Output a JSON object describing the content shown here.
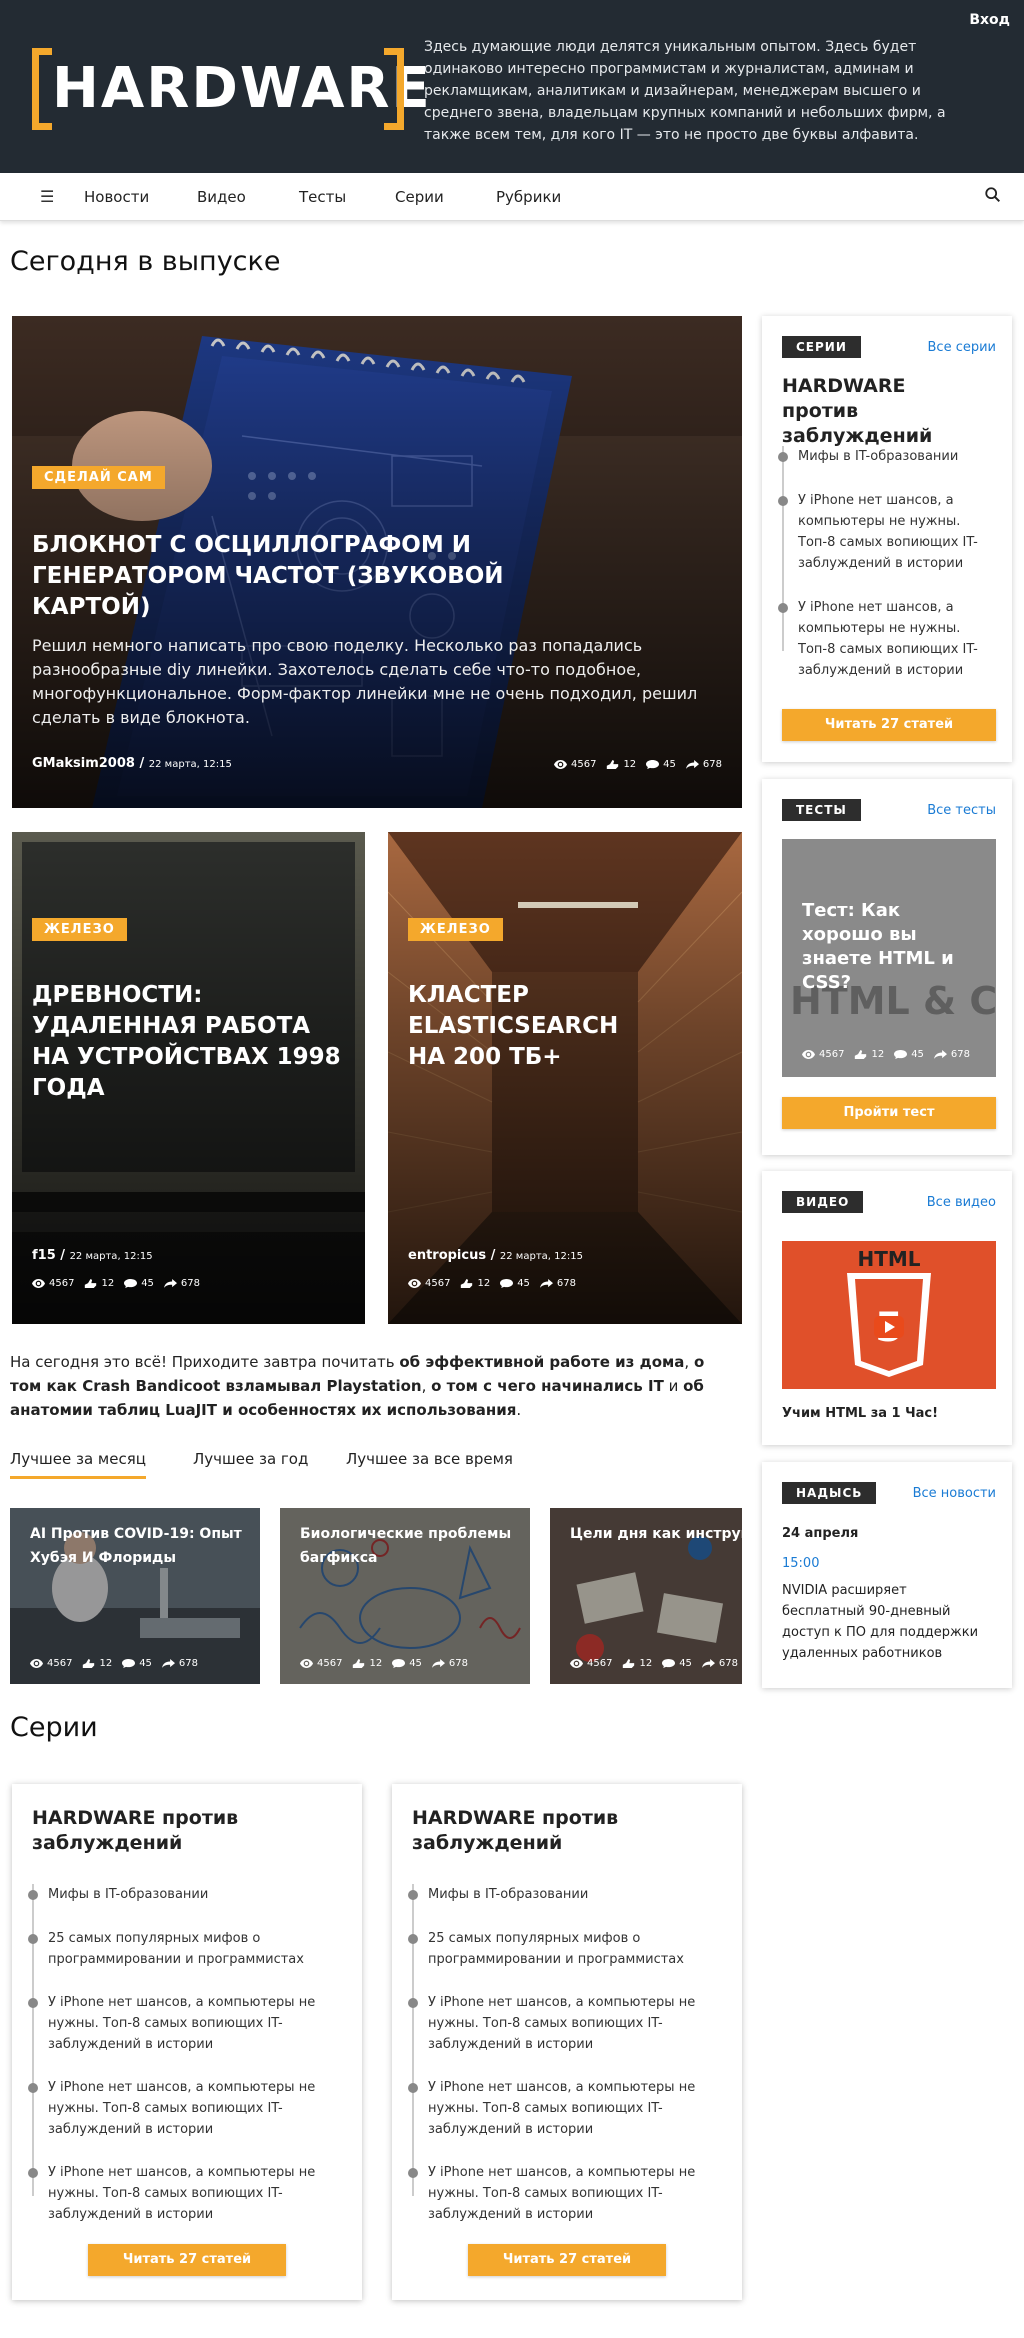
{
  "header": {
    "logo_text": "HARDWARE",
    "tagline": "Здесь думающие люди делятся уникальным опытом. Здесь будет одинаково интересно программистам и журналистам, админам и рекламщикам, аналитикам и дизайнерам, менеджерам высшего и среднего звена, владельцам крупных компаний и небольших фирм, а также всем тем, для кого IT — это не просто две буквы алфавита.",
    "login": "Вход"
  },
  "nav": {
    "menu_icon": "hamburger-icon",
    "items": [
      "Новости",
      "Видео",
      "Тесты",
      "Серии",
      "Рубрики"
    ],
    "search_icon": "search-icon"
  },
  "today_heading": "Сегодня в выпуске",
  "featured": {
    "badge": "СДЕЛАЙ САМ",
    "title": "Блокнот с осциллографом и генератором частот (звуковой картой)",
    "desc": "Решил немного написать про свою поделку. Несколько раз попадались разнообразные diy линейки. Захотелось сделать себе что-то подобное, многофункциональное. Форм-фактор линейки мне не очень подходил, решил сделать в виде блокнота.",
    "author": "GMaksim2008",
    "date": "22 марта, 12:15",
    "views": "4567",
    "likes": "12",
    "comments": "45",
    "shares": "678"
  },
  "cards": [
    {
      "badge": "ЖЕЛЕЗО",
      "title": "Древности: удаленная работа на устройствах 1998 года",
      "author": "f15",
      "date": "22 марта, 12:15",
      "views": "4567",
      "likes": "12",
      "comments": "45",
      "shares": "678"
    },
    {
      "badge": "ЖЕЛЕЗО",
      "title": "Кластер Elasticsearch на 200 ТБ+",
      "author": "entropicus",
      "date": "22 марта, 12:15",
      "views": "4567",
      "likes": "12",
      "comments": "45",
      "shares": "678"
    }
  ],
  "closing": {
    "lead": "На сегодня это всё! Приходите завтра почитать ",
    "bold1": "об эффективной работе из дома",
    "sep1": ", ",
    "bold2": "о том как Crash Bandicoot взламывал Playstation",
    "sep2": ", ",
    "bold3": "о том с чего начинались IT",
    "sep3": " и ",
    "bold4": "об анатомии таблиц LuaJIT и особенностях их использования",
    "end": "."
  },
  "best_tabs": [
    "Лучшее за месяц",
    "Лучшее за год",
    "Лучшее за все время"
  ],
  "best": [
    {
      "title": "AI Против COVID-19: Опыт Хубэя И Флориды",
      "views": "4567",
      "likes": "12",
      "comments": "45",
      "shares": "678"
    },
    {
      "title": "Биологические проблемы багфикса",
      "views": "4567",
      "likes": "12",
      "comments": "45",
      "shares": "678"
    },
    {
      "title": "Цели дня как инструмент управления командой",
      "views": "4567",
      "likes": "12",
      "comments": "45",
      "shares": "678"
    }
  ],
  "series_heading": "Серии",
  "side_series": {
    "tag": "СЕРИИ",
    "all": "Все серии",
    "title": "HARDWARE против заблуждений",
    "items": [
      "Мифы в IT-образовании",
      "У iPhone нет шансов, а компьютеры не нужны. Топ-8 самых вопиющих IT-заблуждений в истории",
      "У iPhone нет шансов, а компьютеры не нужны. Топ-8 самых вопиющих IT-заблуждений в истории"
    ],
    "button": "Читать 27 статей"
  },
  "side_tests": {
    "tag": "ТЕСТЫ",
    "all": "Все тесты",
    "title": "Тест: Как хорошо вы знаете HTML и CSS?",
    "image_text": "HTML & CSS",
    "views": "4567",
    "likes": "12",
    "comments": "45",
    "shares": "678",
    "button": "Пройти тест"
  },
  "side_video": {
    "tag": "ВИДЕО",
    "all": "Все видео",
    "image_text": "HTML",
    "image_number": "5",
    "caption": "Учим HTML за 1 Час!"
  },
  "side_news": {
    "tag": "НАДЫСЬ",
    "all": "Все новости",
    "date": "24 апреля",
    "time": "15:00",
    "text": "NVIDIA расширяет бесплатный 90-дневный доступ к ПО для поддержки удаленных работников"
  },
  "series_cards": [
    {
      "title": "HARDWARE против заблуждений",
      "items": [
        "Мифы в IT-образовании",
        "25 самых популярных мифов о программировании и программистах",
        "У iPhone нет шансов, а компьютеры не нужны. Топ-8 самых вопиющих IT-заблуждений в истории",
        "У iPhone нет шансов, а компьютеры не нужны. Топ-8 самых вопиющих IT-заблуждений в истории",
        "У iPhone нет шансов, а компьютеры не нужны. Топ-8 самых вопиющих IT-заблуждений в истории"
      ],
      "button": "Читать 27 статей"
    },
    {
      "title": "HARDWARE против заблуждений",
      "items": [
        "Мифы в IT-образовании",
        "25 самых популярных мифов о программировании и программистах",
        "У iPhone нет шансов, а компьютеры не нужны. Топ-8 самых вопиющих IT-заблуждений в истории",
        "У iPhone нет шансов, а компьютеры не нужны. Топ-8 самых вопиющих IT-заблуждений в истории",
        "У iPhone нет шансов, а компьютеры не нужны. Топ-8 самых вопиющих IT-заблуждений в истории"
      ],
      "button": "Читать 27 статей"
    }
  ],
  "colors": {
    "accent": "#f4a82c",
    "header_bg": "#232b33",
    "link": "#1a7bd4"
  }
}
